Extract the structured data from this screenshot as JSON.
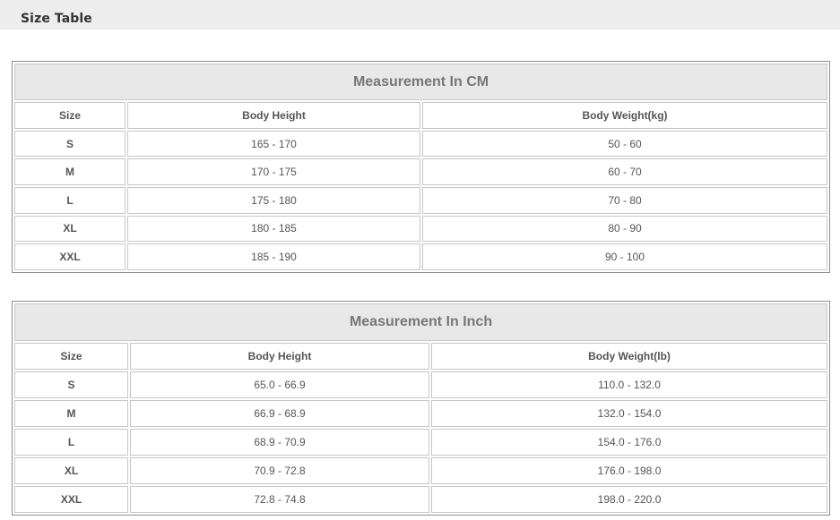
{
  "page": {
    "title": "Size Table"
  },
  "tables": [
    {
      "title": "Measurement In CM",
      "headers": [
        "Size",
        "Body Height",
        "Body Weight(kg)"
      ],
      "rows": [
        [
          "S",
          "165 - 170",
          "50 - 60"
        ],
        [
          "M",
          "170 - 175",
          "60 - 70"
        ],
        [
          "L",
          "175 - 180",
          "70 - 80"
        ],
        [
          "XL",
          "180 - 185",
          "80 - 90"
        ],
        [
          "XXL",
          "185 - 190",
          "90 - 100"
        ]
      ]
    },
    {
      "title": "Measurement In Inch",
      "headers": [
        "Size",
        "Body Height",
        "Body Weight(lb)"
      ],
      "rows": [
        [
          "S",
          "65.0 - 66.9",
          "110.0 - 132.0"
        ],
        [
          "M",
          "66.9 - 68.9",
          "132.0 - 154.0"
        ],
        [
          "L",
          "68.9 - 70.9",
          "154.0 - 176.0"
        ],
        [
          "XL",
          "70.9 - 72.8",
          "176.0 - 198.0"
        ],
        [
          "XXL",
          "72.8 - 74.8",
          "198.0 - 220.0"
        ]
      ]
    }
  ]
}
